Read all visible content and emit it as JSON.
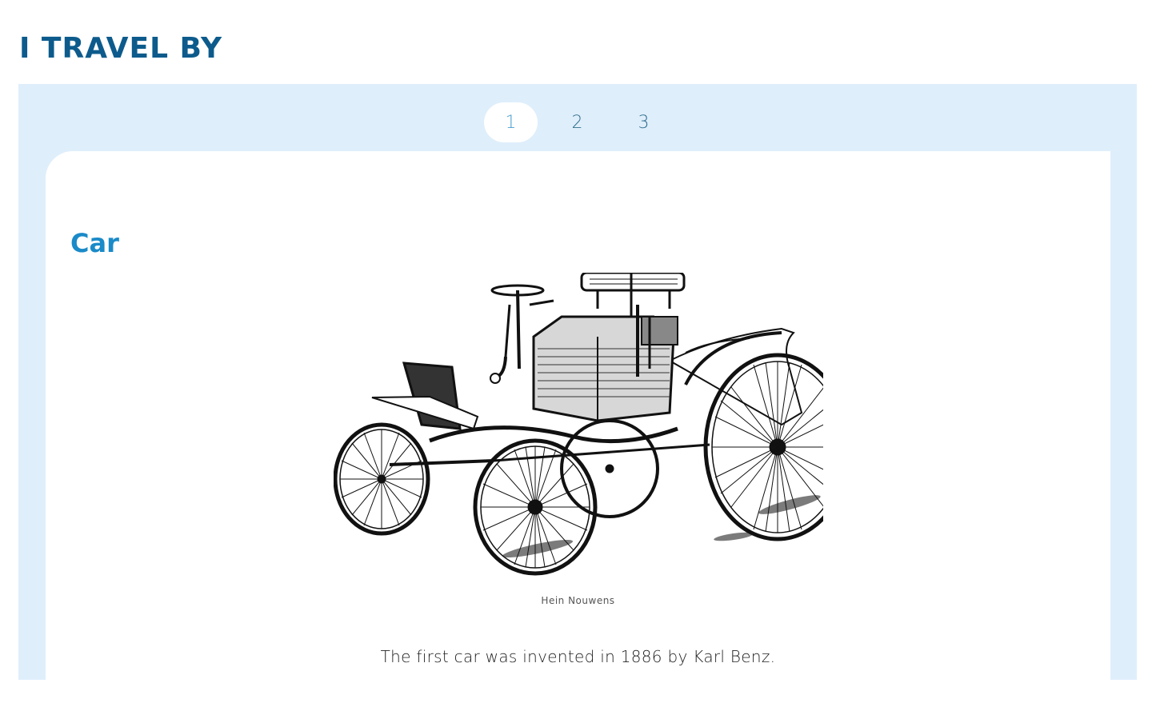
{
  "page": {
    "title": "I TRAVEL BY"
  },
  "pager": {
    "pages": [
      "1",
      "2",
      "3"
    ],
    "active": "1"
  },
  "slide": {
    "heading": "Car",
    "image_caption": "Hein Nouwens",
    "text": "The first car was invented in 1886 by Karl Benz."
  },
  "colors": {
    "title": "#0d5b8c",
    "heading": "#1a8ac8",
    "panel_bg": "#dfeefb",
    "active_page_text": "#4a9fd1"
  }
}
